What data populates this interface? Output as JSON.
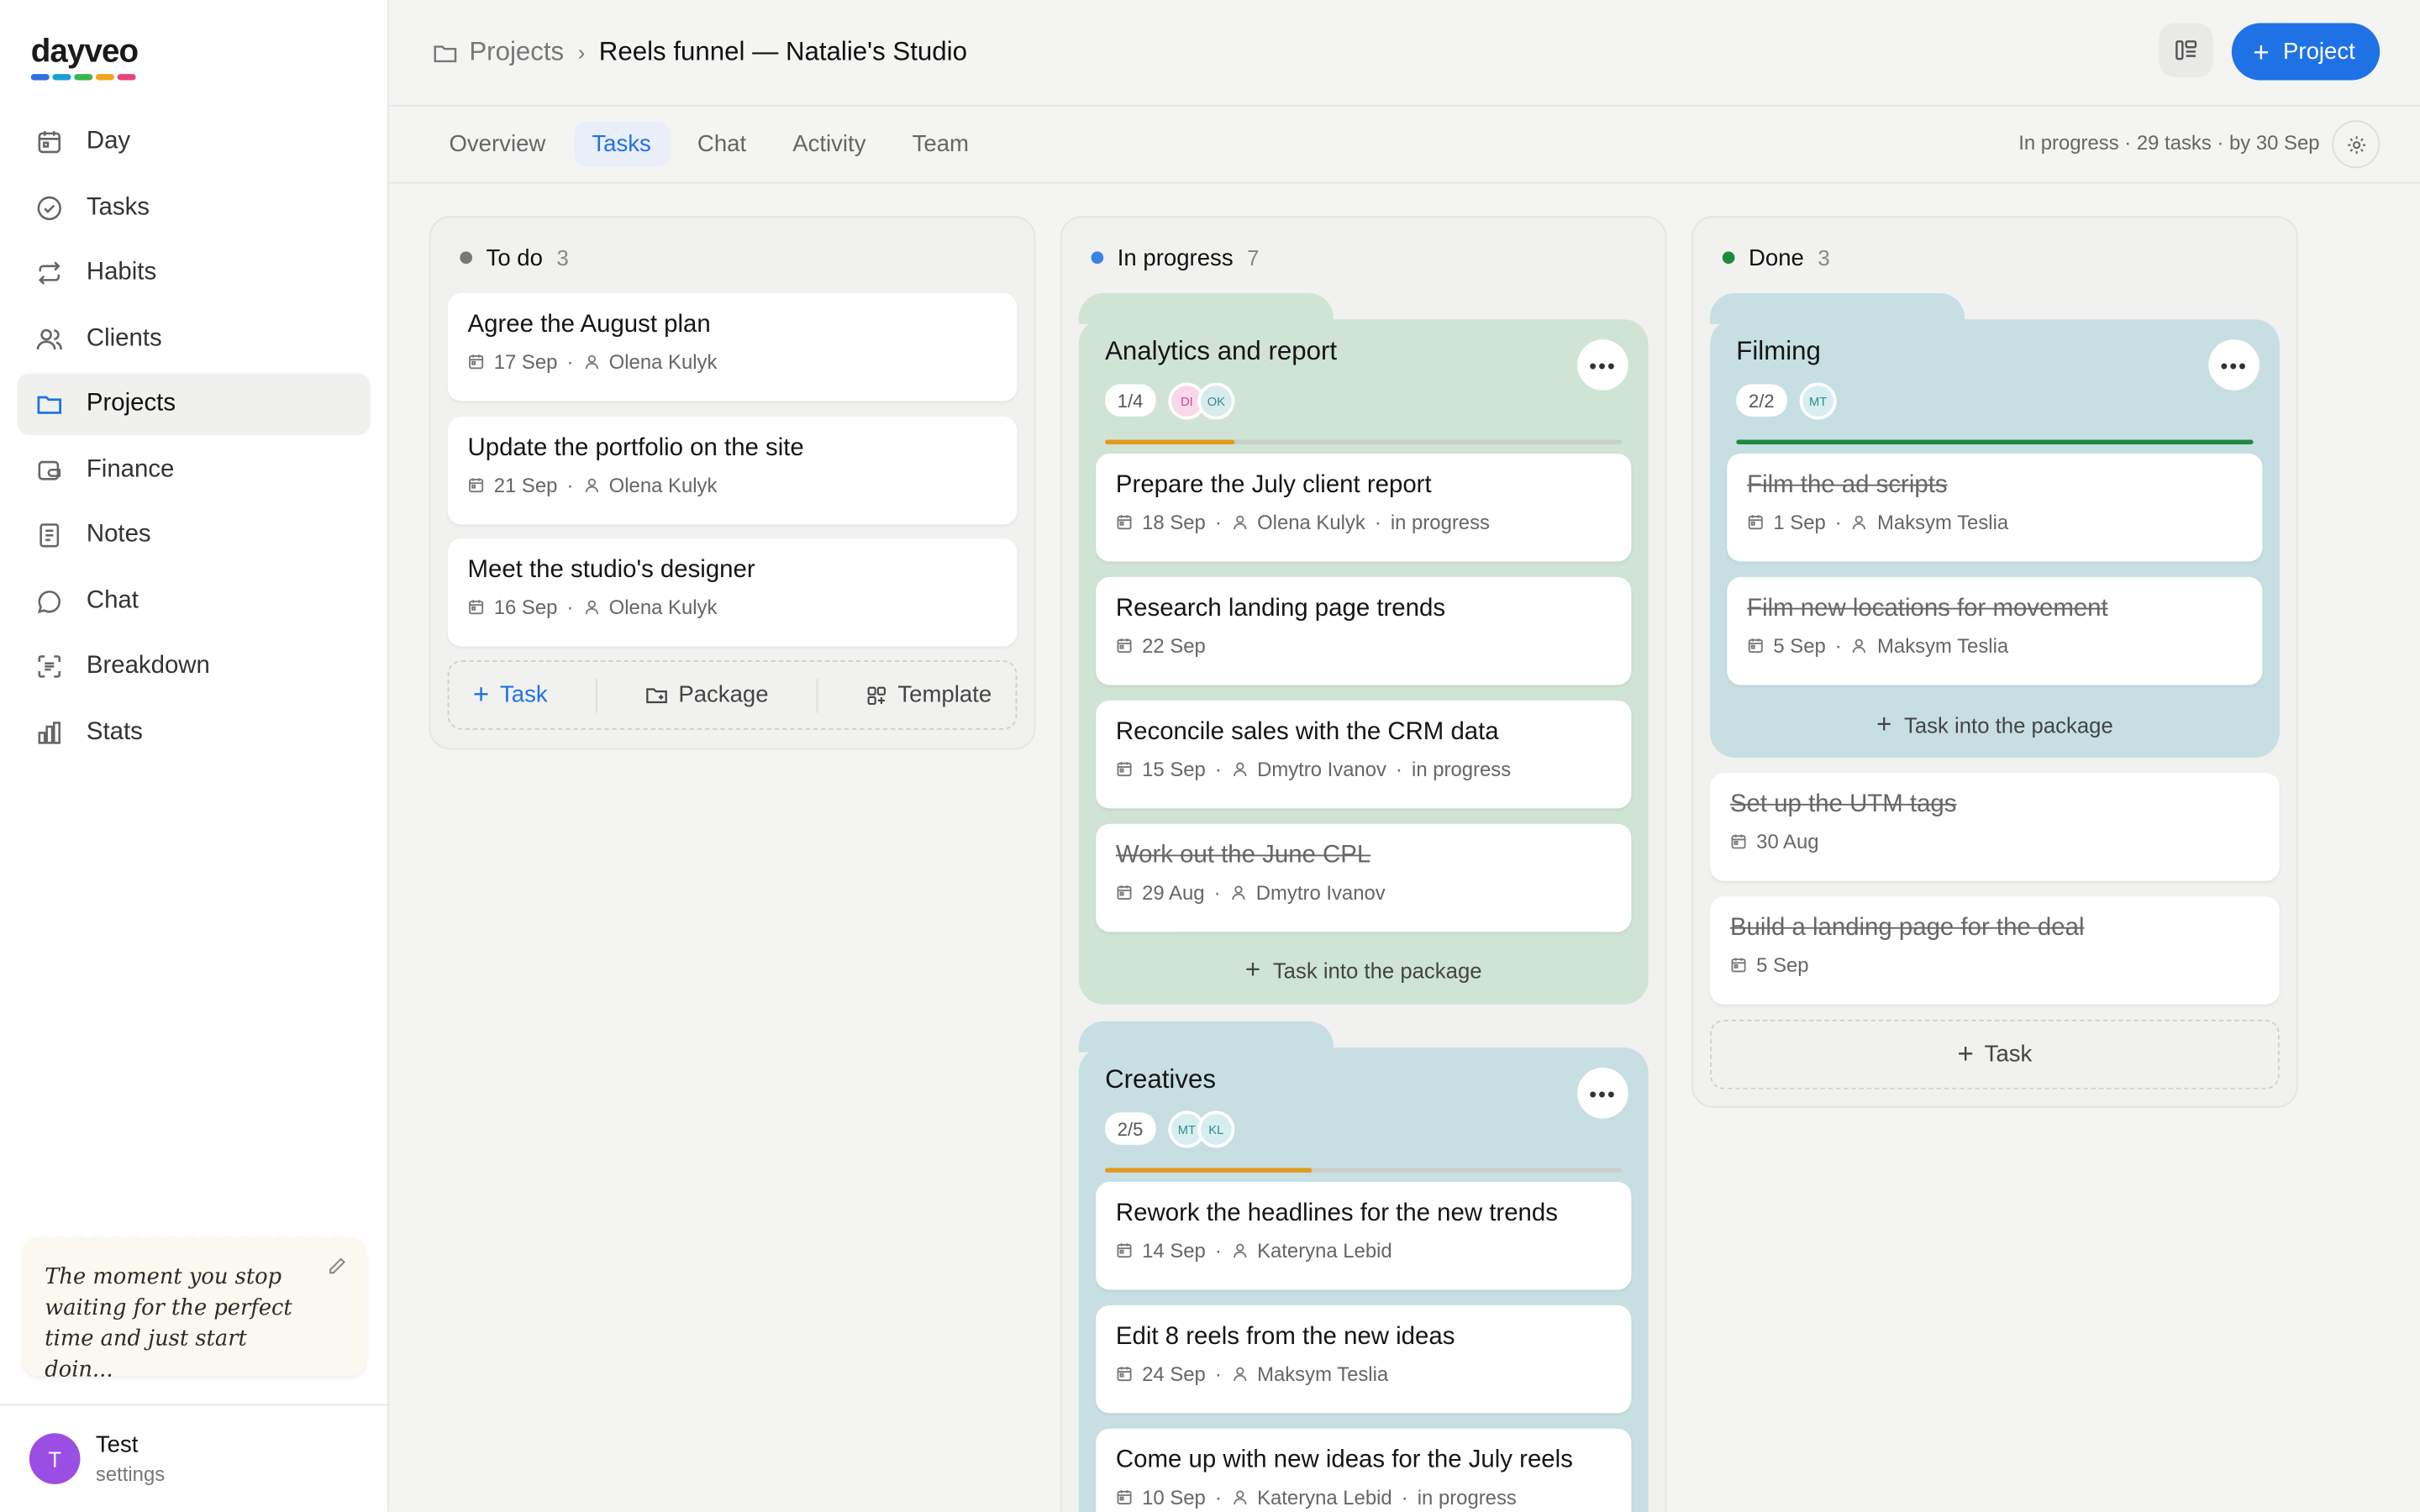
{
  "brand": {
    "name": "dayveo",
    "colors": [
      "#2f6fe0",
      "#1aa0d8",
      "#3cb451",
      "#f2a51a",
      "#e5457a"
    ]
  },
  "nav": {
    "items": [
      {
        "label": "Day",
        "icon": "calendar-icon"
      },
      {
        "label": "Tasks",
        "icon": "check-circle-icon"
      },
      {
        "label": "Habits",
        "icon": "repeat-icon"
      },
      {
        "label": "Clients",
        "icon": "users-icon"
      },
      {
        "label": "Projects",
        "icon": "folder-icon",
        "active": true
      },
      {
        "label": "Finance",
        "icon": "wallet-icon"
      },
      {
        "label": "Notes",
        "icon": "note-icon"
      },
      {
        "label": "Chat",
        "icon": "chat-bubble-icon"
      },
      {
        "label": "Breakdown",
        "icon": "scan-icon"
      },
      {
        "label": "Stats",
        "icon": "bar-chart-icon"
      }
    ]
  },
  "quote": {
    "text": "The moment you stop waiting for the perfect time and just start doin..."
  },
  "user": {
    "initial": "T",
    "name": "Test",
    "sub": "settings"
  },
  "breadcrumb": {
    "root": "Projects",
    "sep": "›",
    "title": "Reels funnel — Natalie's Studio"
  },
  "header": {
    "new_project": "Project"
  },
  "tabs": [
    {
      "label": "Overview"
    },
    {
      "label": "Tasks",
      "active": true
    },
    {
      "label": "Chat"
    },
    {
      "label": "Activity"
    },
    {
      "label": "Team"
    }
  ],
  "summary": "In progress · 29 tasks · by 30 Sep",
  "columns": {
    "todo": {
      "title": "To do",
      "count": "3",
      "color": "#777777",
      "cards": [
        {
          "title": "Agree the August plan",
          "date": "17 Sep",
          "person": "Olena Kulyk"
        },
        {
          "title": "Update the portfolio on the site",
          "date": "21 Sep",
          "person": "Olena Kulyk"
        },
        {
          "title": "Meet the studio's designer",
          "date": "16 Sep",
          "person": "Olena Kulyk"
        }
      ],
      "add": {
        "task": "Task",
        "package": "Package",
        "template": "Template"
      }
    },
    "progress": {
      "title": "In progress",
      "count": "7",
      "color": "#3b82e6",
      "packages": [
        {
          "title": "Analytics and report",
          "badge": "1/4",
          "progress": 0.25,
          "bg": "#cfe4d5",
          "bar": "#e29a1e",
          "chips": [
            {
              "text": "DI",
              "bg": "#f7d9ea",
              "fg": "#c94a8f"
            },
            {
              "text": "OK",
              "bg": "#d7ecec",
              "fg": "#3c8a8a"
            }
          ],
          "cards": [
            {
              "title": "Prepare the July client report",
              "date": "18 Sep",
              "person": "Olena Kulyk",
              "status": "in progress"
            },
            {
              "title": "Research landing page trends",
              "date": "22 Sep"
            },
            {
              "title": "Reconcile sales with the CRM data",
              "date": "15 Sep",
              "person": "Dmytro Ivanov",
              "status": "in progress"
            },
            {
              "title": "Work out the June CPL",
              "date": "29 Aug",
              "person": "Dmytro Ivanov",
              "done": true
            }
          ],
          "add": "Task into the package"
        },
        {
          "title": "Creatives",
          "badge": "2/5",
          "progress": 0.4,
          "bg": "#c7dfe3",
          "bar": "#e29a1e",
          "chips": [
            {
              "text": "MT",
              "bg": "#d6eef0",
              "fg": "#2f8b95"
            },
            {
              "text": "KL",
              "bg": "#d6eef0",
              "fg": "#2f8b95"
            }
          ],
          "cards": [
            {
              "title": "Rework the headlines for the new trends",
              "date": "14 Sep",
              "person": "Kateryna Lebid"
            },
            {
              "title": "Edit 8 reels from the new ideas",
              "date": "24 Sep",
              "person": "Maksym Teslia"
            },
            {
              "title": "Come up with new ideas for the July reels",
              "date": "10 Sep",
              "person": "Kateryna Lebid",
              "status": "in progress"
            }
          ]
        }
      ]
    },
    "done": {
      "title": "Done",
      "count": "3",
      "color": "#1f8a3e",
      "package": {
        "title": "Filming",
        "badge": "2/2",
        "progress": 1.0,
        "bg": "#c7dfe3",
        "bar": "#1f8a3e",
        "chips": [
          {
            "text": "MT",
            "bg": "#d6eef0",
            "fg": "#2f8b95"
          }
        ],
        "cards": [
          {
            "title": "Film the ad scripts",
            "date": "1 Sep",
            "person": "Maksym Teslia",
            "done": true
          },
          {
            "title": "Film new locations for movement",
            "date": "5 Sep",
            "person": "Maksym Teslia",
            "done": true
          }
        ],
        "add": "Task into the package"
      },
      "cards": [
        {
          "title": "Set up the UTM tags",
          "date": "30 Aug",
          "done": true
        },
        {
          "title": "Build a landing page for the deal",
          "date": "5 Sep",
          "done": true
        }
      ],
      "add": "Task"
    }
  }
}
